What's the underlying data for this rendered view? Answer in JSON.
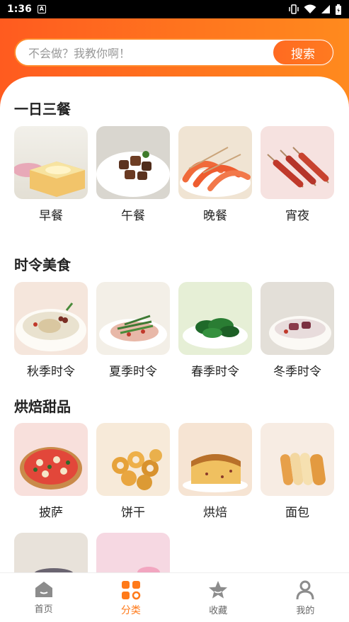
{
  "status_bar": {
    "time": "1:36",
    "notification": "A"
  },
  "search": {
    "placeholder": "不会做？我教你啊！",
    "button": "搜索"
  },
  "sections": [
    {
      "title": "一日三餐",
      "items": [
        {
          "label": "早餐",
          "icon": "breakfast-toast"
        },
        {
          "label": "午餐",
          "icon": "beef-cubes"
        },
        {
          "label": "晚餐",
          "icon": "shrimp"
        },
        {
          "label": "宵夜",
          "icon": "skewers"
        }
      ]
    },
    {
      "title": "时令美食",
      "items": [
        {
          "label": "秋季时令",
          "icon": "soup-bowl"
        },
        {
          "label": "夏季时令",
          "icon": "salad"
        },
        {
          "label": "春季时令",
          "icon": "greens"
        },
        {
          "label": "冬季时令",
          "icon": "stew"
        }
      ]
    },
    {
      "title": "烘焙甜品",
      "items": [
        {
          "label": "披萨",
          "icon": "pizza"
        },
        {
          "label": "饼干",
          "icon": "cookies"
        },
        {
          "label": "烘焙",
          "icon": "cake"
        },
        {
          "label": "面包",
          "icon": "bread"
        }
      ]
    }
  ],
  "tabbar": [
    {
      "label": "首页",
      "icon": "home-icon",
      "active": false
    },
    {
      "label": "分类",
      "icon": "category-icon",
      "active": true
    },
    {
      "label": "收藏",
      "icon": "star-icon",
      "active": false
    },
    {
      "label": "我的",
      "icon": "user-icon",
      "active": false
    }
  ],
  "colors": {
    "accent": "#ff7a1a",
    "header_start": "#ff5b1f",
    "header_end": "#ff8a1e"
  }
}
